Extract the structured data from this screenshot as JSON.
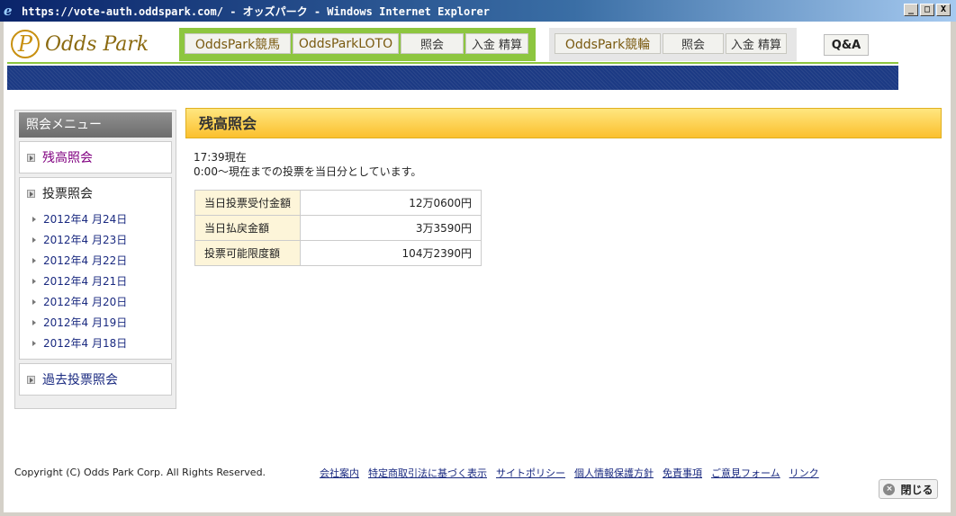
{
  "window": {
    "title": "https://vote-auth.oddspark.com/ - オッズパーク - Windows Internet Explorer",
    "minimize": "_",
    "maximize": "□",
    "close": "X"
  },
  "header": {
    "logo_mark": "P",
    "logo_text": "Odds Park",
    "nav_green": [
      "OddsPark競馬",
      "OddsParkLOTO",
      "照会",
      "入金 精算"
    ],
    "nav_gray": [
      "OddsPark競輪",
      "照会",
      "入金 精算"
    ],
    "qa_label": "Q&A"
  },
  "sidebar": {
    "title": "照会メニュー",
    "balance_link": "残高照会",
    "vote_title": "投票照会",
    "dates": [
      "2012年4 月24日",
      "2012年4 月23日",
      "2012年4 月22日",
      "2012年4 月21日",
      "2012年4 月20日",
      "2012年4 月19日",
      "2012年4 月18日"
    ],
    "past_link": "過去投票照会"
  },
  "main": {
    "title": "残高照会",
    "time": "17:39現在",
    "description": "0:00～現在までの投票を当日分としています。",
    "rows": [
      {
        "label": "当日投票受付金額",
        "value": "12万0600円"
      },
      {
        "label": "当日払戻金額",
        "value": "3万3590円"
      },
      {
        "label": "投票可能限度額",
        "value": "104万2390円"
      }
    ]
  },
  "footer": {
    "copyright": "Copyright (C) Odds Park Corp. All Rights Reserved.",
    "links": [
      "会社案内",
      "特定商取引法に基づく表示",
      "サイトポリシー",
      "個人情報保護方針",
      "免責事項",
      "ご意見フォーム",
      "リンク"
    ],
    "close_icon": "×",
    "close_label": "閉じる"
  }
}
